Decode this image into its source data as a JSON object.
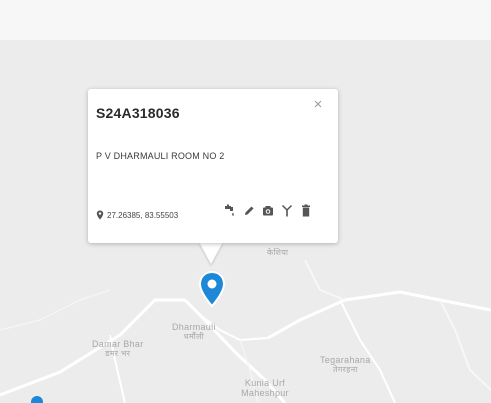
{
  "map": {
    "places": [
      {
        "name": "Damar Bhar",
        "native": "डमर भर"
      },
      {
        "name": "Dharmauli",
        "native": "धर्मौली"
      },
      {
        "name": "Tegarahana",
        "native": "तेगरहना"
      },
      {
        "name": "Kunia Urf Maheshpur",
        "native": ""
      },
      {
        "name": "",
        "native": "केशिया"
      }
    ]
  },
  "popup": {
    "title": "S24A318036",
    "address": "P V DHARMAULI ROOM NO 2",
    "coordinates": "27.26385, 83.55503",
    "close_icon": "×",
    "actions": [
      "water-tap-icon",
      "pencil-icon",
      "camera-icon",
      "antenna-icon",
      "trash-icon"
    ]
  },
  "colors": {
    "marker": "#1e88d8",
    "map_bg": "#ececec",
    "road": "#ffffff"
  }
}
